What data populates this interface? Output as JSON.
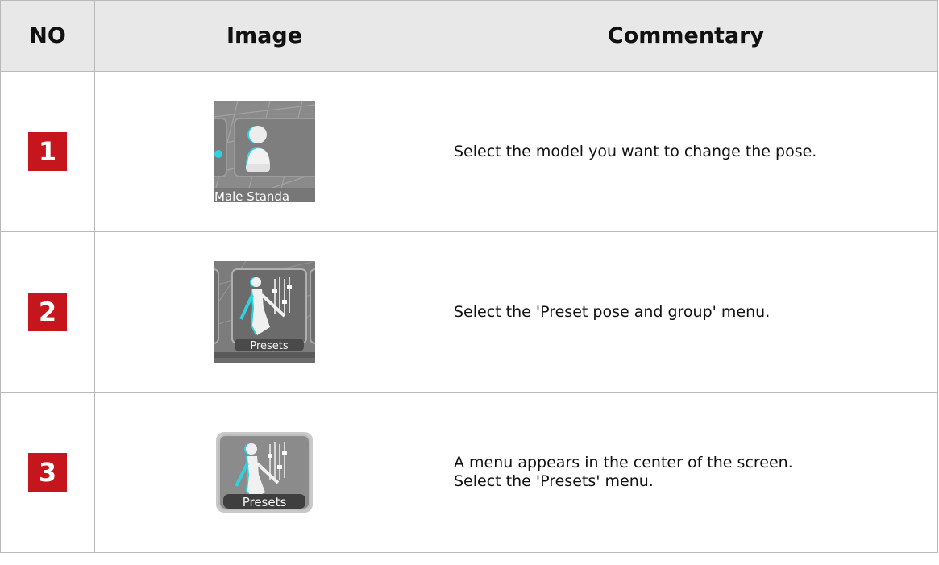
{
  "headers": {
    "no": "NO",
    "image": "Image",
    "commentary": "Commentary"
  },
  "rows": [
    {
      "no": "1",
      "image_label": "Male Standa",
      "image_icon": "male-standard-model-icon",
      "commentary": [
        "Select the model you want to change the pose."
      ]
    },
    {
      "no": "2",
      "image_label": "Presets",
      "image_icon": "presets-menu-icon",
      "commentary": [
        "Select the 'Preset pose and group' menu."
      ]
    },
    {
      "no": "3",
      "image_label": "Presets",
      "image_icon": "presets-button-icon",
      "commentary": [
        "A menu appears in the center of the screen.",
        "Select the 'Presets' menu."
      ]
    }
  ],
  "colors": {
    "badge": "#c4161c",
    "header_bg": "#e8e8e8",
    "border": "#b9b9b9",
    "accent_cyan": "#2fd3e0"
  }
}
